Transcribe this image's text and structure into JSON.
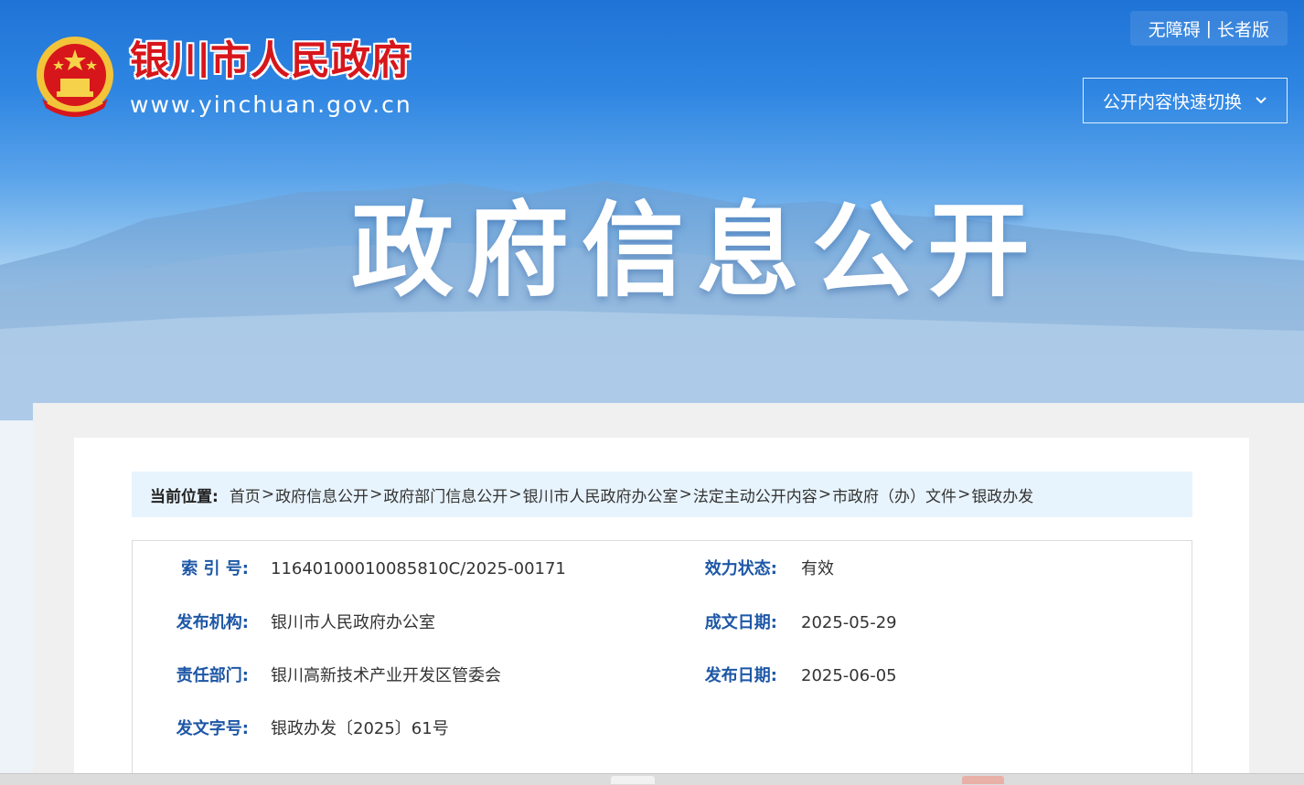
{
  "header": {
    "site_name": "银川市人民政府",
    "site_url": "www.yinchuan.gov.cn",
    "accessibility": "无障碍",
    "separator": "|",
    "elder_mode": "长者版",
    "quick_switch": "公开内容快速切换",
    "hero_title": "政府信息公开"
  },
  "breadcrumb": {
    "label": "当前位置:",
    "separator": ">",
    "items": [
      "首页",
      "政府信息公开",
      "政府部门信息公开",
      "银川市人民政府办公室",
      "法定主动公开内容",
      "市政府（办）文件",
      "银政办发"
    ]
  },
  "meta": {
    "index_label": "索 引 号:",
    "index_value": "11640100010085810C/2025-00171",
    "status_label": "效力状态:",
    "status_value": "有效",
    "publisher_label": "发布机构:",
    "publisher_value": "银川市人民政府办公室",
    "created_label": "成文日期:",
    "created_value": "2025-05-29",
    "dept_label": "责任部门:",
    "dept_value": "银川高新技术产业开发区管委会",
    "published_label": "发布日期:",
    "published_value": "2025-06-05",
    "docno_label": "发文字号:",
    "docno_value": "银政办发〔2025〕61号"
  },
  "colors": {
    "brand_red": "#d7161b",
    "label_blue": "#1d57a6",
    "breadcrumb_bg": "#e8f4fd"
  },
  "icons": {
    "emblem": "national-emblem-icon",
    "quick_switch": "chevron-down-icon"
  }
}
